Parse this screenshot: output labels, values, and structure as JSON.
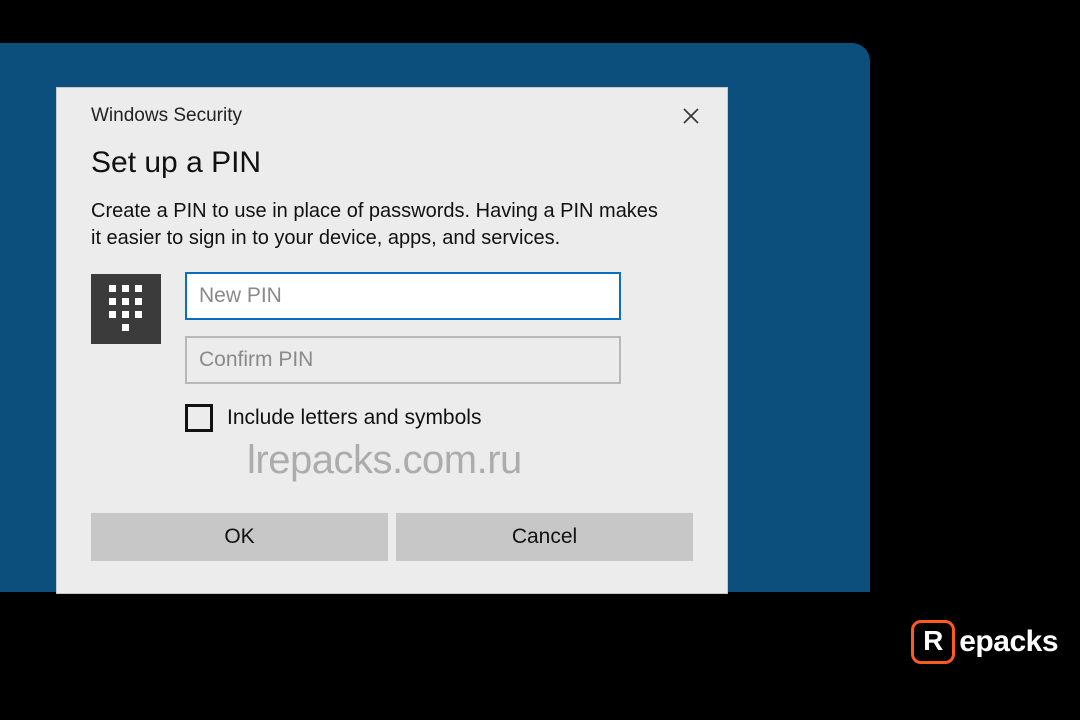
{
  "dialog": {
    "window_title": "Windows Security",
    "heading": "Set up a PIN",
    "description": "Create a PIN to use in place of passwords. Having a PIN makes it easier to sign in to your device, apps, and services.",
    "new_pin_placeholder": "New PIN",
    "confirm_pin_placeholder": "Confirm PIN",
    "checkbox_label": "Include letters and symbols",
    "ok_label": "OK",
    "cancel_label": "Cancel"
  },
  "watermark": "lrepacks.com.ru",
  "brand": {
    "icon_letter": "R",
    "text": "epacks"
  }
}
